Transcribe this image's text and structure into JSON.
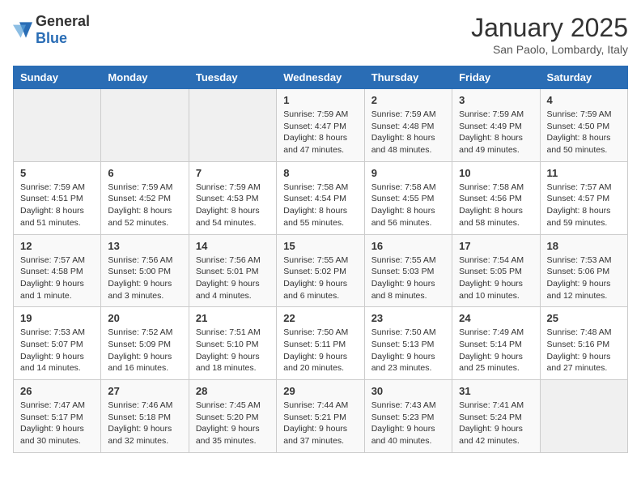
{
  "logo": {
    "general": "General",
    "blue": "Blue"
  },
  "header": {
    "title": "January 2025",
    "subtitle": "San Paolo, Lombardy, Italy"
  },
  "weekdays": [
    "Sunday",
    "Monday",
    "Tuesday",
    "Wednesday",
    "Thursday",
    "Friday",
    "Saturday"
  ],
  "weeks": [
    [
      {
        "day": "",
        "empty": true
      },
      {
        "day": "",
        "empty": true
      },
      {
        "day": "",
        "empty": true
      },
      {
        "day": "1",
        "sunrise": "7:59 AM",
        "sunset": "4:47 PM",
        "daylight": "8 hours and 47 minutes."
      },
      {
        "day": "2",
        "sunrise": "7:59 AM",
        "sunset": "4:48 PM",
        "daylight": "8 hours and 48 minutes."
      },
      {
        "day": "3",
        "sunrise": "7:59 AM",
        "sunset": "4:49 PM",
        "daylight": "8 hours and 49 minutes."
      },
      {
        "day": "4",
        "sunrise": "7:59 AM",
        "sunset": "4:50 PM",
        "daylight": "8 hours and 50 minutes."
      }
    ],
    [
      {
        "day": "5",
        "sunrise": "7:59 AM",
        "sunset": "4:51 PM",
        "daylight": "8 hours and 51 minutes."
      },
      {
        "day": "6",
        "sunrise": "7:59 AM",
        "sunset": "4:52 PM",
        "daylight": "8 hours and 52 minutes."
      },
      {
        "day": "7",
        "sunrise": "7:59 AM",
        "sunset": "4:53 PM",
        "daylight": "8 hours and 54 minutes."
      },
      {
        "day": "8",
        "sunrise": "7:58 AM",
        "sunset": "4:54 PM",
        "daylight": "8 hours and 55 minutes."
      },
      {
        "day": "9",
        "sunrise": "7:58 AM",
        "sunset": "4:55 PM",
        "daylight": "8 hours and 56 minutes."
      },
      {
        "day": "10",
        "sunrise": "7:58 AM",
        "sunset": "4:56 PM",
        "daylight": "8 hours and 58 minutes."
      },
      {
        "day": "11",
        "sunrise": "7:57 AM",
        "sunset": "4:57 PM",
        "daylight": "8 hours and 59 minutes."
      }
    ],
    [
      {
        "day": "12",
        "sunrise": "7:57 AM",
        "sunset": "4:58 PM",
        "daylight": "9 hours and 1 minute."
      },
      {
        "day": "13",
        "sunrise": "7:56 AM",
        "sunset": "5:00 PM",
        "daylight": "9 hours and 3 minutes."
      },
      {
        "day": "14",
        "sunrise": "7:56 AM",
        "sunset": "5:01 PM",
        "daylight": "9 hours and 4 minutes."
      },
      {
        "day": "15",
        "sunrise": "7:55 AM",
        "sunset": "5:02 PM",
        "daylight": "9 hours and 6 minutes."
      },
      {
        "day": "16",
        "sunrise": "7:55 AM",
        "sunset": "5:03 PM",
        "daylight": "9 hours and 8 minutes."
      },
      {
        "day": "17",
        "sunrise": "7:54 AM",
        "sunset": "5:05 PM",
        "daylight": "9 hours and 10 minutes."
      },
      {
        "day": "18",
        "sunrise": "7:53 AM",
        "sunset": "5:06 PM",
        "daylight": "9 hours and 12 minutes."
      }
    ],
    [
      {
        "day": "19",
        "sunrise": "7:53 AM",
        "sunset": "5:07 PM",
        "daylight": "9 hours and 14 minutes."
      },
      {
        "day": "20",
        "sunrise": "7:52 AM",
        "sunset": "5:09 PM",
        "daylight": "9 hours and 16 minutes."
      },
      {
        "day": "21",
        "sunrise": "7:51 AM",
        "sunset": "5:10 PM",
        "daylight": "9 hours and 18 minutes."
      },
      {
        "day": "22",
        "sunrise": "7:50 AM",
        "sunset": "5:11 PM",
        "daylight": "9 hours and 20 minutes."
      },
      {
        "day": "23",
        "sunrise": "7:50 AM",
        "sunset": "5:13 PM",
        "daylight": "9 hours and 23 minutes."
      },
      {
        "day": "24",
        "sunrise": "7:49 AM",
        "sunset": "5:14 PM",
        "daylight": "9 hours and 25 minutes."
      },
      {
        "day": "25",
        "sunrise": "7:48 AM",
        "sunset": "5:16 PM",
        "daylight": "9 hours and 27 minutes."
      }
    ],
    [
      {
        "day": "26",
        "sunrise": "7:47 AM",
        "sunset": "5:17 PM",
        "daylight": "9 hours and 30 minutes."
      },
      {
        "day": "27",
        "sunrise": "7:46 AM",
        "sunset": "5:18 PM",
        "daylight": "9 hours and 32 minutes."
      },
      {
        "day": "28",
        "sunrise": "7:45 AM",
        "sunset": "5:20 PM",
        "daylight": "9 hours and 35 minutes."
      },
      {
        "day": "29",
        "sunrise": "7:44 AM",
        "sunset": "5:21 PM",
        "daylight": "9 hours and 37 minutes."
      },
      {
        "day": "30",
        "sunrise": "7:43 AM",
        "sunset": "5:23 PM",
        "daylight": "9 hours and 40 minutes."
      },
      {
        "day": "31",
        "sunrise": "7:41 AM",
        "sunset": "5:24 PM",
        "daylight": "9 hours and 42 minutes."
      },
      {
        "day": "",
        "empty": true
      }
    ]
  ]
}
